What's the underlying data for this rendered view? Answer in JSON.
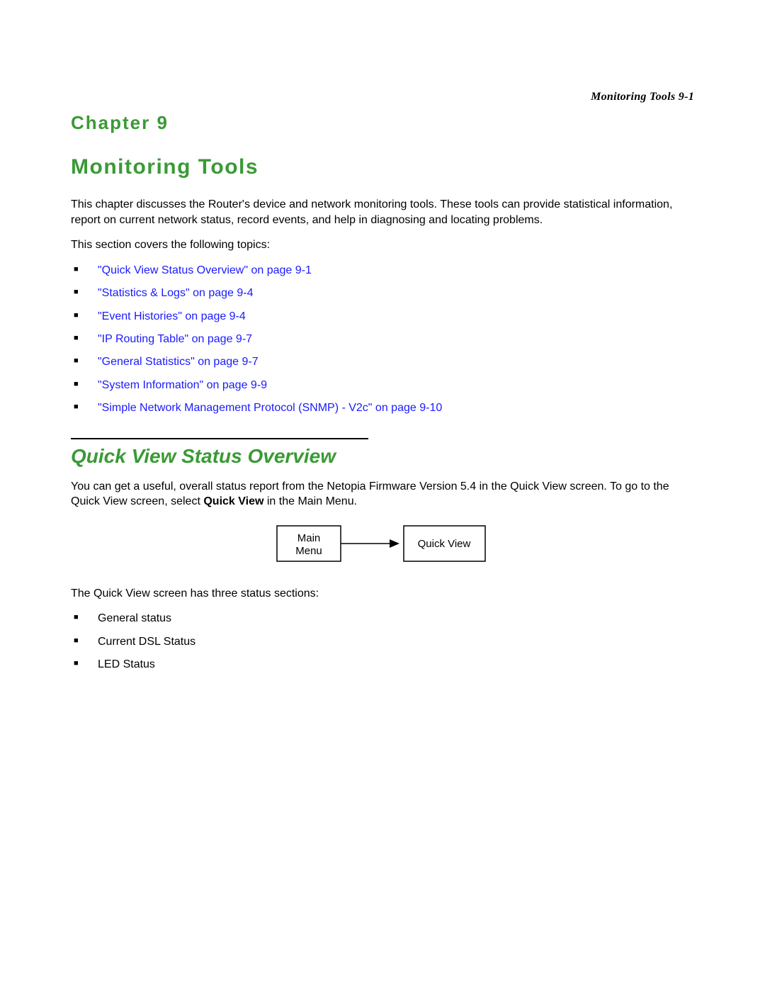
{
  "running_head": "Monitoring Tools   9-1",
  "chapter_label": "Chapter 9",
  "chapter_title": "Monitoring Tools",
  "intro_para": "This chapter discusses the Router's device and network monitoring tools. These tools can provide statistical information, report on current network status, record events, and help in diagnosing and locating problems.",
  "topics_lead": "This section covers the following topics:",
  "topics": [
    "\"Quick View Status Overview\" on page 9-1",
    "\"Statistics & Logs\" on page 9-4",
    "\"Event Histories\" on page 9-4",
    "\"IP Routing Table\" on page 9-7",
    "\"General Statistics\" on page 9-7",
    "\"System Information\" on page 9-9",
    "\"Simple Network Management Protocol (SNMP) - V2c\" on page 9-10"
  ],
  "section1": {
    "title": "Quick View Status Overview",
    "para_pre": "You can get a useful, overall status report from the Netopia Firmware Version 5.4 in the Quick View screen. To go to the Quick View screen, select ",
    "para_bold": "Quick View",
    "para_post": " in the Main Menu.",
    "diagram": {
      "left_line1": "Main",
      "left_line2": "Menu",
      "right": "Quick View"
    },
    "after_diagram": "The Quick View screen has three status sections:",
    "status_items": [
      "General status",
      "Current DSL Status",
      "LED Status"
    ]
  }
}
